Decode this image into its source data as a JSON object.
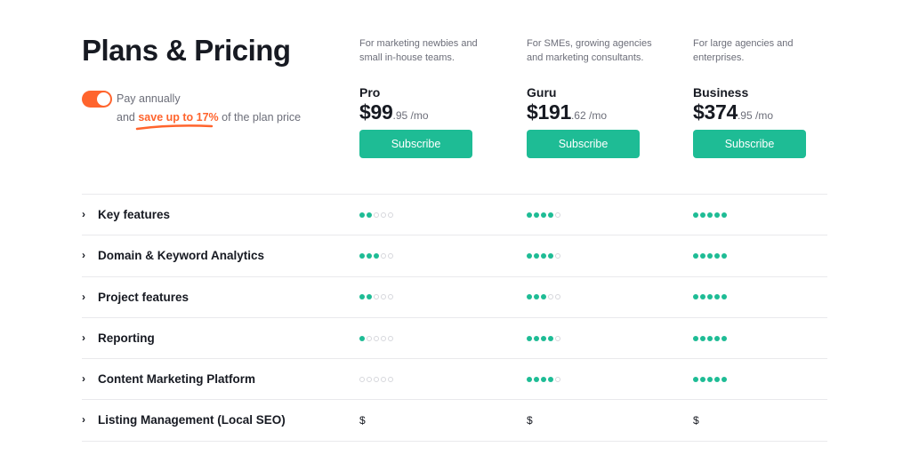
{
  "header": {
    "title": "Plans & Pricing",
    "toggle_label": "Pay annually",
    "toggle_on": true,
    "save_prefix": "and",
    "save_highlight": "save up to 17%",
    "save_suffix": "of the plan price"
  },
  "colors": {
    "accent_orange": "#ff642d",
    "accent_green": "#1ebc95",
    "dot_empty": "#d6d7dc"
  },
  "plans": [
    {
      "description": "For marketing newbies and small in-house teams.",
      "name": "Pro",
      "price_main": "$99",
      "price_cents": ".95 /mo",
      "button_label": "Subscribe"
    },
    {
      "description": "For SMEs, growing agencies and marketing consultants.",
      "name": "Guru",
      "price_main": "$191",
      "price_cents": ".62 /mo",
      "button_label": "Subscribe"
    },
    {
      "description": "For large agencies and enterprises.",
      "name": "Business",
      "price_main": "$374",
      "price_cents": ".95 /mo",
      "button_label": "Subscribe"
    }
  ],
  "features": {
    "max_rating": 5,
    "rows": [
      {
        "label": "Key features",
        "values": [
          2,
          4,
          5
        ]
      },
      {
        "label": "Domain & Keyword Analytics",
        "values": [
          3,
          4,
          5
        ]
      },
      {
        "label": "Project features",
        "values": [
          2,
          3,
          5
        ]
      },
      {
        "label": "Reporting",
        "values": [
          1,
          4,
          5
        ]
      },
      {
        "label": "Content Marketing Platform",
        "values": [
          0,
          4,
          5
        ]
      },
      {
        "label": "Listing Management (Local SEO)",
        "values": [
          "$",
          "$",
          "$"
        ]
      }
    ],
    "expand_icon": "chevron-right-icon"
  }
}
